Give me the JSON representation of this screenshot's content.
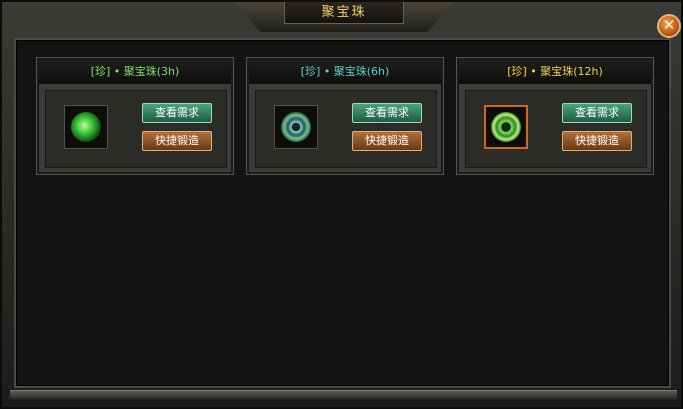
{
  "window": {
    "title": "聚宝珠",
    "close_label": "✕"
  },
  "cards": [
    {
      "title": "[珍] • 聚宝珠(3h)",
      "title_color": "#7fe06a",
      "icon": "green-orb-icon",
      "view_label": "查看需求",
      "forge_label": "快捷锻造"
    },
    {
      "title": "[珍] • 聚宝珠(6h)",
      "title_color": "#5fd0c8",
      "icon": "blue-rune-orb-icon",
      "view_label": "查看需求",
      "forge_label": "快捷锻造"
    },
    {
      "title": "[珍] • 聚宝珠(12h)",
      "title_color": "#f0d34a",
      "icon": "dragon-orb-icon",
      "view_label": "查看需求",
      "forge_label": "快捷锻造"
    }
  ]
}
